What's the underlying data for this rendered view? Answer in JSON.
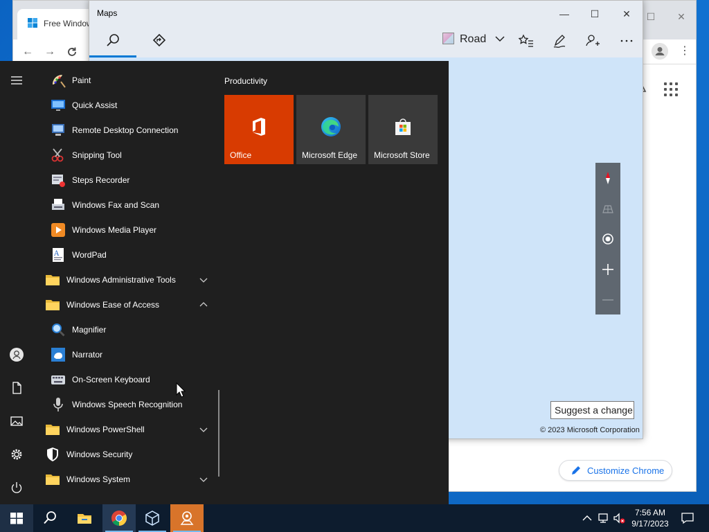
{
  "chrome": {
    "tab_title": "Free Windows",
    "customize_label": "Customize Chrome",
    "close_glyph": "✕",
    "maximize_glyph": "☐"
  },
  "maps": {
    "title": "Maps",
    "map_style_label": "Road",
    "suggest_label": "Suggest a change",
    "copyright": "© 2023 Microsoft Corporation",
    "controls": {
      "minimize": "—",
      "maximize": "☐",
      "close": "✕"
    }
  },
  "start_menu": {
    "rail": [
      "hamburger-icon",
      "user-icon",
      "documents-icon",
      "pictures-icon",
      "settings-icon",
      "power-icon"
    ],
    "apps": [
      {
        "label": "Paint",
        "icon": "paint-icon"
      },
      {
        "label": "Quick Assist",
        "icon": "quick-assist-icon"
      },
      {
        "label": "Remote Desktop Connection",
        "icon": "remote-desktop-icon"
      },
      {
        "label": "Snipping Tool",
        "icon": "snipping-tool-icon"
      },
      {
        "label": "Steps Recorder",
        "icon": "steps-recorder-icon"
      },
      {
        "label": "Windows Fax and Scan",
        "icon": "fax-scan-icon"
      },
      {
        "label": "Windows Media Player",
        "icon": "media-player-icon"
      },
      {
        "label": "WordPad",
        "icon": "wordpad-icon"
      },
      {
        "label": "Windows Administrative Tools",
        "icon": "folder-icon",
        "folder": true,
        "expanded": false
      },
      {
        "label": "Windows Ease of Access",
        "icon": "folder-icon",
        "folder": true,
        "expanded": true
      },
      {
        "label": "Magnifier",
        "icon": "magnifier-icon"
      },
      {
        "label": "Narrator",
        "icon": "narrator-icon"
      },
      {
        "label": "On-Screen Keyboard",
        "icon": "keyboard-icon"
      },
      {
        "label": "Windows Speech Recognition",
        "icon": "microphone-icon"
      },
      {
        "label": "Windows PowerShell",
        "icon": "folder-icon",
        "folder": true,
        "expanded": false
      },
      {
        "label": "Windows Security",
        "icon": "shield-icon",
        "folder": true,
        "nochevron": true
      },
      {
        "label": "Windows System",
        "icon": "folder-icon",
        "folder": true,
        "expanded": false
      }
    ],
    "group_title": "Productivity",
    "tiles": [
      {
        "label": "Office",
        "color": "#d83b01"
      },
      {
        "label": "Microsoft Edge",
        "color": "#3a3a3a"
      },
      {
        "label": "Microsoft Store",
        "color": "#3a3a3a"
      }
    ]
  },
  "taskbar": {
    "time": "7:56 AM",
    "date": "9/17/2023"
  },
  "colors": {
    "accent": "#0078d4",
    "office_tile": "#d83b01",
    "start_bg": "#1f1f1f",
    "taskbar_bg": "#0d1c2e"
  }
}
